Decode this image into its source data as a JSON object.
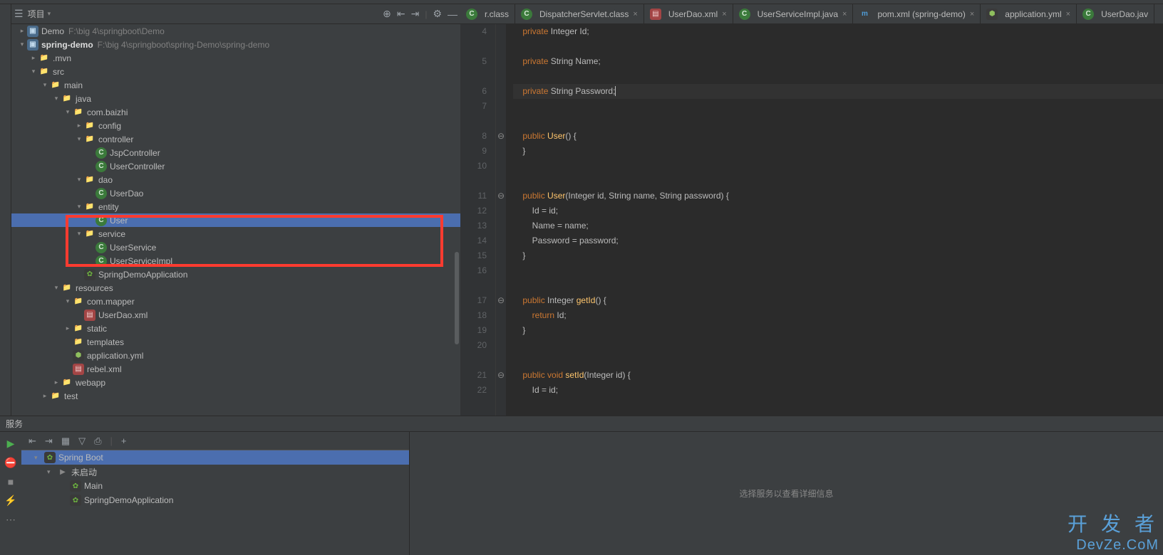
{
  "sidebar": {
    "title": "项目",
    "toolbarIcons": [
      "target-icon",
      "collapse-icon",
      "expand-icon",
      "divider",
      "gear-icon",
      "minimize-icon"
    ]
  },
  "tree": [
    {
      "d": 0,
      "a": "closed",
      "i": "mod",
      "l": "Demo",
      "p": "F:\\big 4\\springboot\\Demo"
    },
    {
      "d": 0,
      "a": "open",
      "i": "mod",
      "l": "spring-demo",
      "p": "F:\\big 4\\springboot\\spring-Demo\\spring-demo",
      "bold": true
    },
    {
      "d": 1,
      "a": "closed",
      "i": "folder",
      "l": ".mvn"
    },
    {
      "d": 1,
      "a": "open",
      "i": "folder",
      "l": "src"
    },
    {
      "d": 2,
      "a": "open",
      "i": "folder",
      "l": "main"
    },
    {
      "d": 3,
      "a": "open",
      "i": "folder",
      "l": "java"
    },
    {
      "d": 4,
      "a": "open",
      "i": "folder",
      "l": "com.baizhi"
    },
    {
      "d": 5,
      "a": "closed",
      "i": "folder",
      "l": "config"
    },
    {
      "d": 5,
      "a": "open",
      "i": "folder",
      "l": "controller"
    },
    {
      "d": 6,
      "a": "none",
      "i": "java",
      "l": "JspController"
    },
    {
      "d": 6,
      "a": "none",
      "i": "java",
      "l": "UserController"
    },
    {
      "d": 5,
      "a": "open",
      "i": "folder",
      "l": "dao"
    },
    {
      "d": 6,
      "a": "none",
      "i": "java",
      "l": "UserDao"
    },
    {
      "d": 5,
      "a": "open",
      "i": "folder",
      "l": "entity"
    },
    {
      "d": 6,
      "a": "none",
      "i": "java",
      "l": "User",
      "sel": true
    },
    {
      "d": 5,
      "a": "open",
      "i": "folder",
      "l": "service"
    },
    {
      "d": 6,
      "a": "none",
      "i": "java",
      "l": "UserService"
    },
    {
      "d": 6,
      "a": "none",
      "i": "java",
      "l": "UserServiceImpl"
    },
    {
      "d": 5,
      "a": "none",
      "i": "spring",
      "l": "SpringDemoApplication"
    },
    {
      "d": 3,
      "a": "open",
      "i": "folder",
      "l": "resources"
    },
    {
      "d": 4,
      "a": "open",
      "i": "folder",
      "l": "com.mapper"
    },
    {
      "d": 5,
      "a": "none",
      "i": "xml",
      "l": "UserDao.xml"
    },
    {
      "d": 4,
      "a": "closed",
      "i": "folder",
      "l": "static"
    },
    {
      "d": 4,
      "a": "none",
      "i": "folder",
      "l": "templates"
    },
    {
      "d": 4,
      "a": "none",
      "i": "yml",
      "l": "application.yml"
    },
    {
      "d": 4,
      "a": "none",
      "i": "xml",
      "l": "rebel.xml"
    },
    {
      "d": 3,
      "a": "closed",
      "i": "folder",
      "l": "webapp"
    },
    {
      "d": 2,
      "a": "closed",
      "i": "folder",
      "l": "test"
    }
  ],
  "tabs": [
    {
      "l": "r.class",
      "i": "java",
      "partial": true
    },
    {
      "l": "DispatcherServlet.class",
      "i": "java"
    },
    {
      "l": "UserDao.xml",
      "i": "xml"
    },
    {
      "l": "UserServiceImpl.java",
      "i": "java"
    },
    {
      "l": "pom.xml (spring-demo)",
      "i": "m"
    },
    {
      "l": "application.yml",
      "i": "yml"
    },
    {
      "l": "UserDao.jav",
      "i": "java",
      "partial": true
    }
  ],
  "code": {
    "start": 4,
    "lines": [
      {
        "n": 4,
        "t": [
          [
            "",
            4
          ],
          [
            "kw",
            "private"
          ],
          [
            "pl",
            " "
          ],
          [
            "ty",
            "Integer"
          ],
          [
            "pl",
            " Id;"
          ]
        ]
      },
      {
        "n": "",
        "t": []
      },
      {
        "n": 5,
        "t": [
          [
            "",
            4
          ],
          [
            "kw",
            "private"
          ],
          [
            "pl",
            " "
          ],
          [
            "ty",
            "String"
          ],
          [
            "pl",
            " Name;"
          ]
        ]
      },
      {
        "n": "",
        "t": []
      },
      {
        "n": 6,
        "cur": true,
        "t": [
          [
            "",
            4
          ],
          [
            "kw",
            "private"
          ],
          [
            "pl",
            " "
          ],
          [
            "ty",
            "String"
          ],
          [
            "pl",
            " Password;"
          ],
          [
            "caret",
            ""
          ]
        ]
      },
      {
        "n": 7,
        "t": []
      },
      {
        "n": "",
        "t": []
      },
      {
        "n": 8,
        "f": "⊖",
        "t": [
          [
            "",
            4
          ],
          [
            "kw",
            "public"
          ],
          [
            "pl",
            " "
          ],
          [
            "mn",
            "User"
          ],
          [
            "pl",
            "() {"
          ]
        ]
      },
      {
        "n": 9,
        "t": [
          [
            "",
            4
          ],
          [
            "pl",
            "}"
          ]
        ]
      },
      {
        "n": 10,
        "t": []
      },
      {
        "n": "",
        "t": []
      },
      {
        "n": 11,
        "f": "⊖",
        "t": [
          [
            "",
            4
          ],
          [
            "kw",
            "public"
          ],
          [
            "pl",
            " "
          ],
          [
            "mn",
            "User"
          ],
          [
            "pl",
            "(Integer id, String name, String password) {"
          ]
        ]
      },
      {
        "n": 12,
        "t": [
          [
            "",
            8
          ],
          [
            "pl",
            "Id = id;"
          ]
        ]
      },
      {
        "n": 13,
        "t": [
          [
            "",
            8
          ],
          [
            "pl",
            "Name = name;"
          ]
        ]
      },
      {
        "n": 14,
        "t": [
          [
            "",
            8
          ],
          [
            "pl",
            "Password = password;"
          ]
        ]
      },
      {
        "n": 15,
        "t": [
          [
            "",
            4
          ],
          [
            "pl",
            "}"
          ]
        ]
      },
      {
        "n": 16,
        "t": []
      },
      {
        "n": "",
        "t": []
      },
      {
        "n": 17,
        "f": "⊖",
        "t": [
          [
            "",
            4
          ],
          [
            "kw",
            "public"
          ],
          [
            "pl",
            " "
          ],
          [
            "ty",
            "Integer"
          ],
          [
            "pl",
            " "
          ],
          [
            "mn",
            "getId"
          ],
          [
            "pl",
            "() {"
          ]
        ]
      },
      {
        "n": 18,
        "t": [
          [
            "",
            8
          ],
          [
            "kw",
            "return"
          ],
          [
            "pl",
            " Id;"
          ]
        ]
      },
      {
        "n": 19,
        "t": [
          [
            "",
            4
          ],
          [
            "pl",
            "}"
          ]
        ]
      },
      {
        "n": 20,
        "t": []
      },
      {
        "n": "",
        "t": []
      },
      {
        "n": 21,
        "f": "⊖",
        "t": [
          [
            "",
            4
          ],
          [
            "kw",
            "public"
          ],
          [
            "pl",
            " "
          ],
          [
            "kw",
            "void"
          ],
          [
            "pl",
            " "
          ],
          [
            "mn",
            "setId"
          ],
          [
            "pl",
            "(Integer id) {"
          ]
        ]
      },
      {
        "n": 22,
        "t": [
          [
            "",
            8
          ],
          [
            "pl",
            "Id = id;"
          ]
        ]
      }
    ]
  },
  "bottom": {
    "title": "服务",
    "hint": "选择服务以查看详细信息",
    "tree": [
      {
        "d": 0,
        "a": "open",
        "i": "spring",
        "l": "Spring Boot",
        "sel": true
      },
      {
        "d": 1,
        "a": "open",
        "i": "run",
        "l": "未启动"
      },
      {
        "d": 2,
        "a": "none",
        "i": "spring",
        "l": "Main"
      },
      {
        "d": 2,
        "a": "none",
        "i": "spring",
        "l": "SpringDemoApplication"
      }
    ]
  },
  "watermark": {
    "l1": "开 发 者",
    "l2": "DevZe.CoM"
  }
}
